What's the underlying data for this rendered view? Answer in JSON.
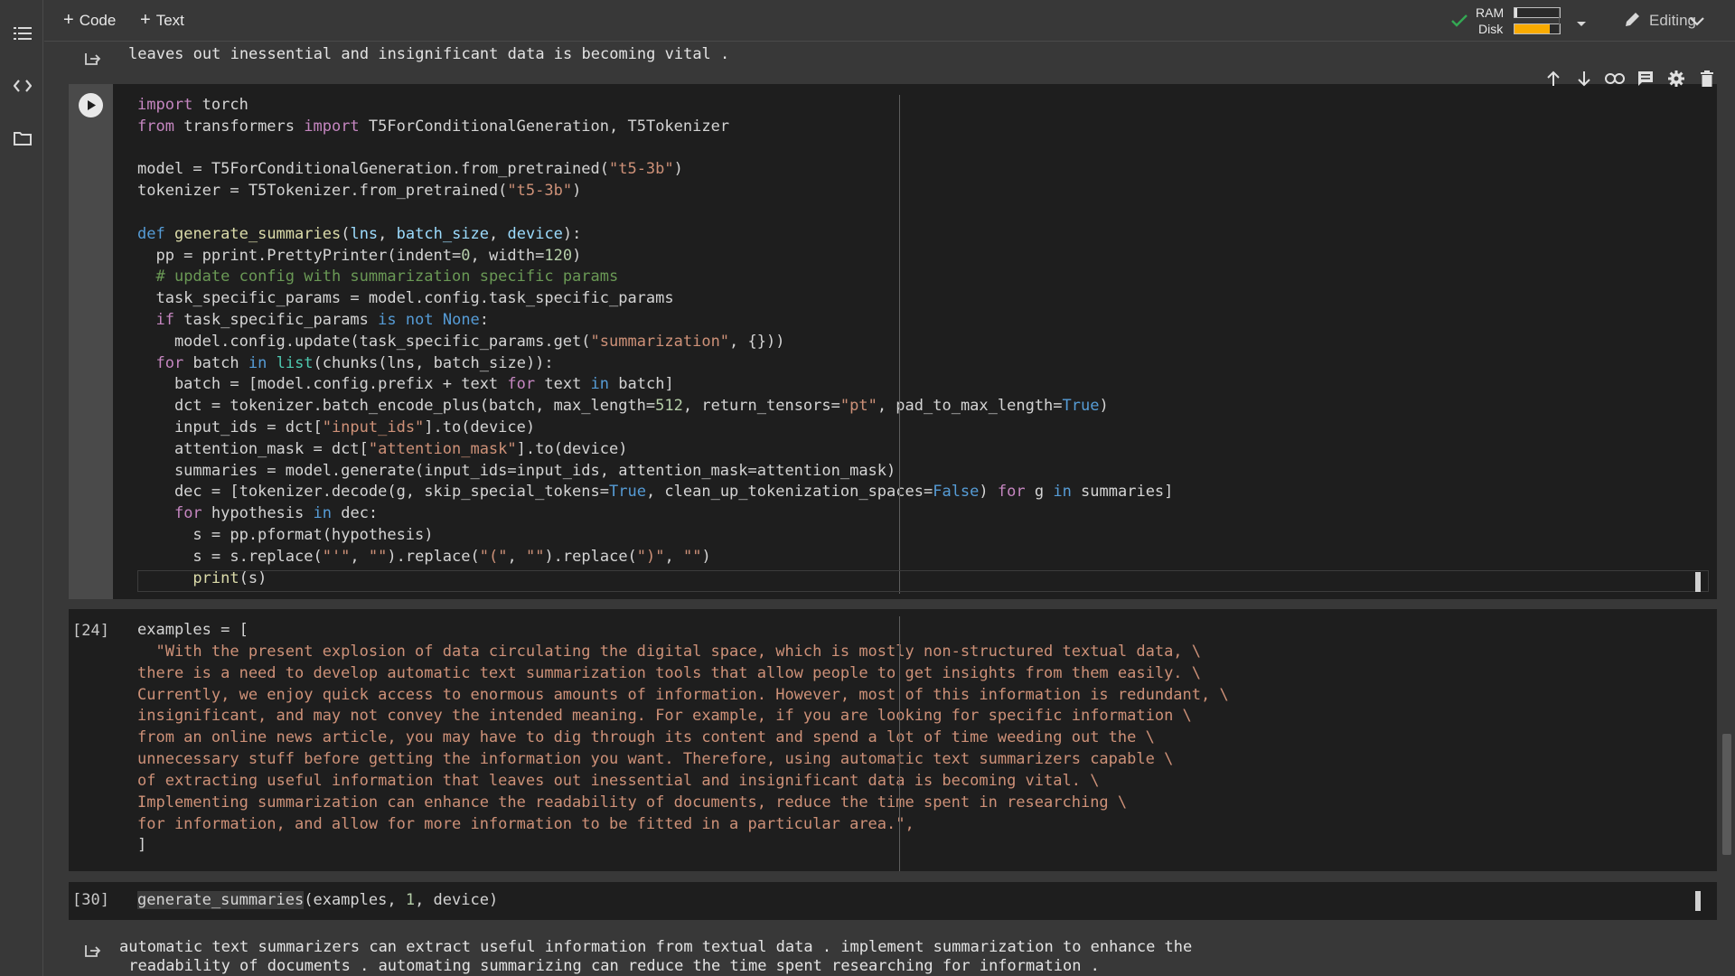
{
  "toolbar": {
    "add_code_label": "Code",
    "add_text_label": "Text",
    "ram_label": "RAM",
    "disk_label": "Disk",
    "ram_usage": 0.05,
    "disk_usage": 0.78,
    "editing_label": "Editing"
  },
  "top_output": {
    "text": "leaves out inessential and insignificant data is becoming vital ."
  },
  "cell_code": {
    "lines": [
      "import torch",
      "from transformers import T5ForConditionalGeneration, T5Tokenizer",
      "",
      "model = T5ForConditionalGeneration.from_pretrained(\"t5-3b\")",
      "tokenizer = T5Tokenizer.from_pretrained(\"t5-3b\")",
      "",
      "def generate_summaries(lns, batch_size, device):",
      "  pp = pprint.PrettyPrinter(indent=0, width=120)",
      "  # update config with summarization specific params",
      "  task_specific_params = model.config.task_specific_params",
      "  if task_specific_params is not None:",
      "    model.config.update(task_specific_params.get(\"summarization\", {}))",
      "  for batch in list(chunks(lns, batch_size)):",
      "    batch = [model.config.prefix + text for text in batch]",
      "    dct = tokenizer.batch_encode_plus(batch, max_length=512, return_tensors=\"pt\", pad_to_max_length=True)",
      "    input_ids = dct[\"input_ids\"].to(device)",
      "    attention_mask = dct[\"attention_mask\"].to(device)",
      "    summaries = model.generate(input_ids=input_ids, attention_mask=attention_mask)",
      "    dec = [tokenizer.decode(g, skip_special_tokens=True, clean_up_tokenization_spaces=False) for g in summaries]",
      "    for hypothesis in dec:",
      "      s = pp.pformat(hypothesis)",
      "      s = s.replace(\"'\", \"\").replace(\"(\", \"\").replace(\")\", \"\")",
      "      print(s)"
    ]
  },
  "cell_examples": {
    "exec_count": "[24]",
    "lines": [
      "examples = [",
      "  \"With the present explosion of data circulating the digital space, which is mostly non-structured textual data, \\",
      "there is a need to develop automatic text summarization tools that allow people to get insights from them easily. \\",
      "Currently, we enjoy quick access to enormous amounts of information. However, most of this information is redundant, \\",
      "insignificant, and may not convey the intended meaning. For example, if you are looking for specific information \\",
      "from an online news article, you may have to dig through its content and spend a lot of time weeding out the \\",
      "unnecessary stuff before getting the information you want. Therefore, using automatic text summarizers capable \\",
      "of extracting useful information that leaves out inessential and insignificant data is becoming vital. \\",
      "Implementing summarization can enhance the readability of documents, reduce the time spent in researching \\",
      "for information, and allow for more information to be fitted in a particular area.\",",
      "]"
    ]
  },
  "cell_call": {
    "exec_count": "[30]",
    "code_fn": "generate_summaries",
    "code_rest_a": "(examples, ",
    "code_num": "1",
    "code_rest_b": ", device)"
  },
  "bottom_output": {
    "line1": "automatic text summarizers can extract useful information from textual data . implement summarization to enhance the",
    "line2": " readability of documents . automating summarizing can reduce the time spent researching for information ."
  },
  "colors": {
    "background": "#383838",
    "cell_bg": "#1e1e1e",
    "string": "#ce9178",
    "keyword": "#c586c0",
    "ok_check": "#34a853",
    "disk_fill": "#f9ab00"
  }
}
